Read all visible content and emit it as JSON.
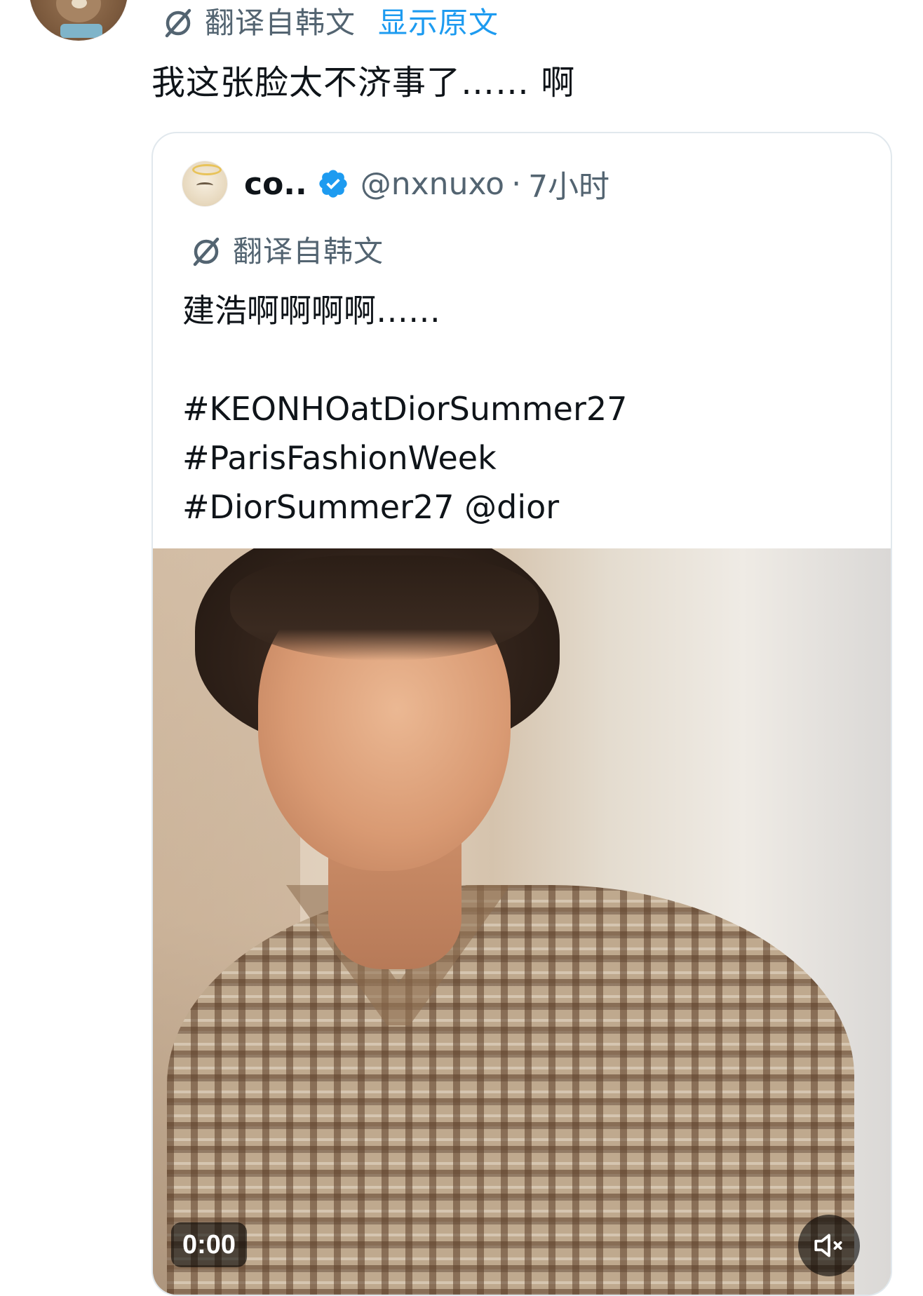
{
  "outer_tweet": {
    "translate_label": "翻译自韩文",
    "show_original": "显示原文",
    "text": "我这张脸太不济事了…… 啊",
    "avatar_icon": "teddy-bear-avatar"
  },
  "quoted_tweet": {
    "display_name": "co..",
    "verified": true,
    "verified_color": "#1d9bf0",
    "handle": "@nxnuxo",
    "separator": "·",
    "time": "7小时",
    "translate_label": "翻译自韩文",
    "body_lines": [
      "建浩啊啊啊啊……",
      "",
      "#KEONHOatDiorSummer27",
      "#ParisFashionWeek",
      "#DiorSummer27 @dior"
    ],
    "video": {
      "timestamp": "0:00",
      "muted": true,
      "mute_icon": "volume-muted-icon"
    }
  },
  "colors": {
    "text_primary": "#0f1419",
    "text_secondary": "#536471",
    "link": "#1d9bf0",
    "card_border": "#e1e8ed"
  }
}
